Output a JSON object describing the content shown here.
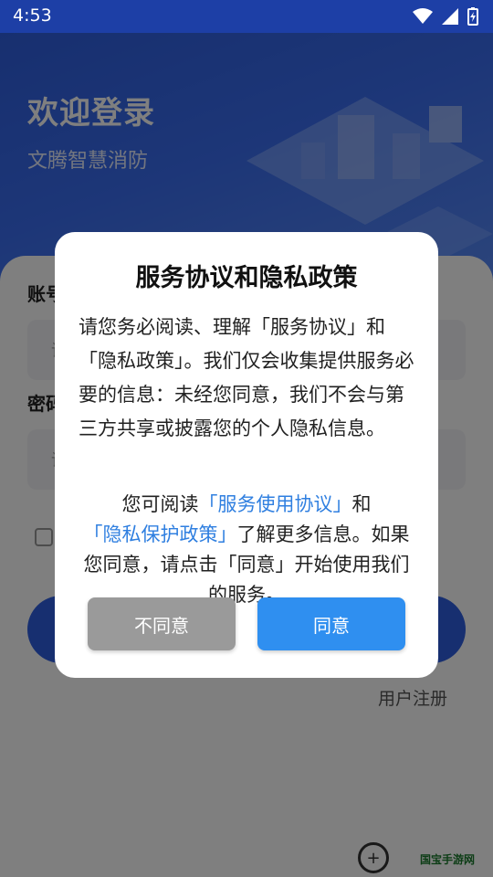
{
  "status_bar": {
    "time": "4:53",
    "icons": [
      "wifi-icon",
      "signal-icon",
      "battery-charging-icon"
    ]
  },
  "header": {
    "title": "欢迎登录",
    "subtitle": "文腾智慧消防"
  },
  "form": {
    "account_label": "账号",
    "account_placeholder": "请",
    "password_label": "密码",
    "password_placeholder": "请",
    "register_link": "用户注册"
  },
  "dialog": {
    "title": "服务协议和隐私政策",
    "body": "请您务必阅读、理解「服务协议」和「隐私政策」。我们仅会收集提供服务必要的信息：未经您同意，我们不会与第三方共享或披露您的个人隐私信息。",
    "para2_prefix": "您可阅读",
    "service_link": "「服务使用协议」",
    "para2_and": "和",
    "privacy_link": "「隐私保护政策」",
    "para2_suffix": "了解更多信息。如果您同意，请点击「同意」开始使用我们的服务。",
    "disagree_label": "不同意",
    "agree_label": "同意"
  },
  "watermark": {
    "text": "国宝手游网"
  },
  "colors": {
    "primary": "#2f5fe0",
    "agree_button": "#2f8ff0",
    "disagree_button": "#9a9a9a",
    "link": "#2f7fe0"
  }
}
